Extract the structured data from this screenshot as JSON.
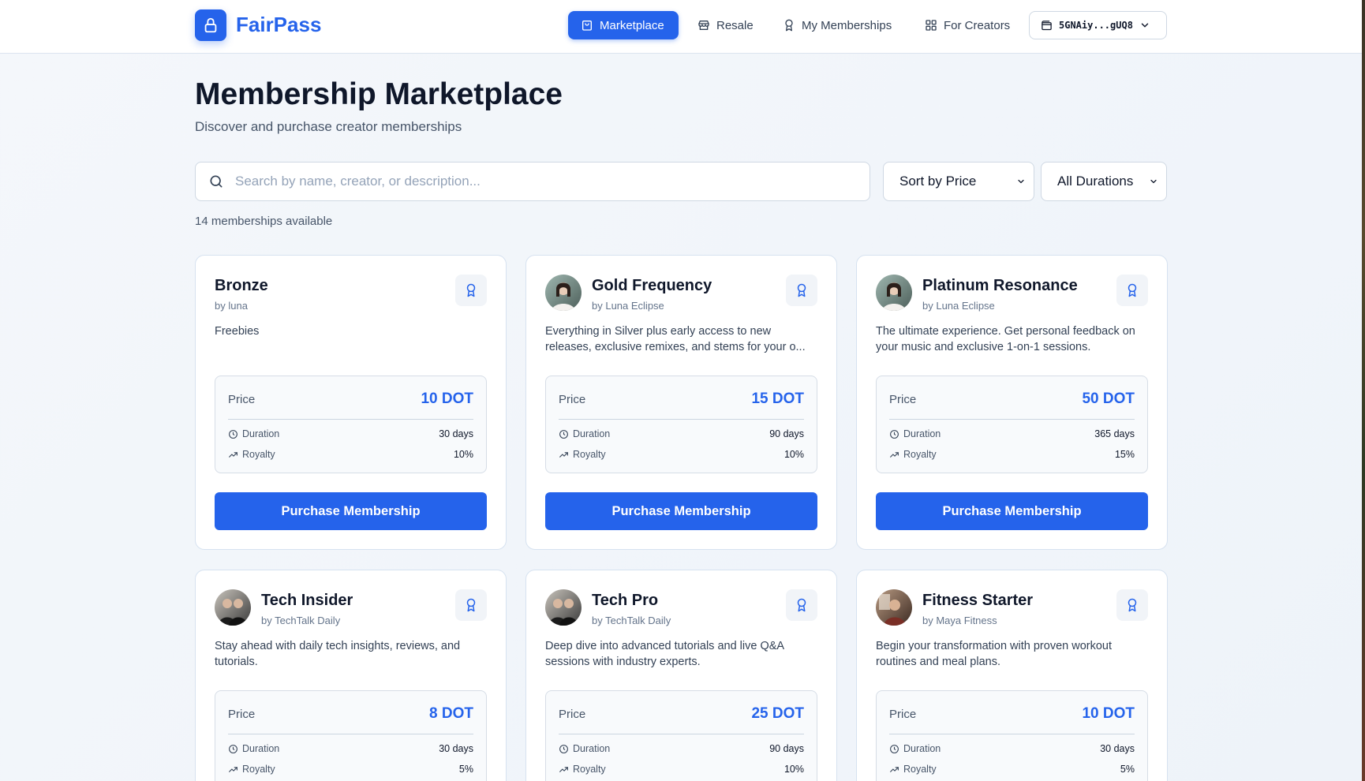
{
  "app": {
    "name": "FairPass"
  },
  "nav": {
    "marketplace": "Marketplace",
    "resale": "Resale",
    "my_memberships": "My Memberships",
    "for_creators": "For Creators",
    "wallet": "5GNAiy...gUQ8"
  },
  "header": {
    "title": "Membership Marketplace",
    "subtitle": "Discover and purchase creator memberships"
  },
  "search": {
    "placeholder": "Search by name, creator, or description...",
    "value": ""
  },
  "filters": {
    "sort": "Sort by Price",
    "duration": "All Durations"
  },
  "count_text": "14 memberships available",
  "labels": {
    "price": "Price",
    "duration": "Duration",
    "royalty": "Royalty",
    "purchase": "Purchase Membership"
  },
  "cards": [
    {
      "title": "Bronze",
      "creator": "by luna",
      "description": "Freebies",
      "price": "10 DOT",
      "duration": "30 days",
      "royalty": "10%"
    },
    {
      "title": "Gold Frequency",
      "creator": "by Luna Eclipse",
      "description": "Everything in Silver plus early access to new releases, exclusive remixes, and stems for your o...",
      "price": "15 DOT",
      "duration": "90 days",
      "royalty": "10%"
    },
    {
      "title": "Platinum Resonance",
      "creator": "by Luna Eclipse",
      "description": "The ultimate experience. Get personal feedback on your music and exclusive 1-on-1 sessions.",
      "price": "50 DOT",
      "duration": "365 days",
      "royalty": "15%"
    },
    {
      "title": "Tech Insider",
      "creator": "by TechTalk Daily",
      "description": "Stay ahead with daily tech insights, reviews, and tutorials.",
      "price": "8 DOT",
      "duration": "30 days",
      "royalty": "5%"
    },
    {
      "title": "Tech Pro",
      "creator": "by TechTalk Daily",
      "description": "Deep dive into advanced tutorials and live Q&A sessions with industry experts.",
      "price": "25 DOT",
      "duration": "90 days",
      "royalty": "10%"
    },
    {
      "title": "Fitness Starter",
      "creator": "by Maya Fitness",
      "description": "Begin your transformation with proven workout routines and meal plans.",
      "price": "10 DOT",
      "duration": "30 days",
      "royalty": "5%"
    }
  ],
  "colors": {
    "accent": "#2563eb",
    "text": "#0f172a",
    "muted": "#475569"
  },
  "icons": [
    "lock-icon",
    "shopping-bag-icon",
    "store-icon",
    "award-icon",
    "grid-icon",
    "wallet-icon",
    "chevron-down-icon",
    "search-icon",
    "clock-icon",
    "trending-up-icon"
  ]
}
